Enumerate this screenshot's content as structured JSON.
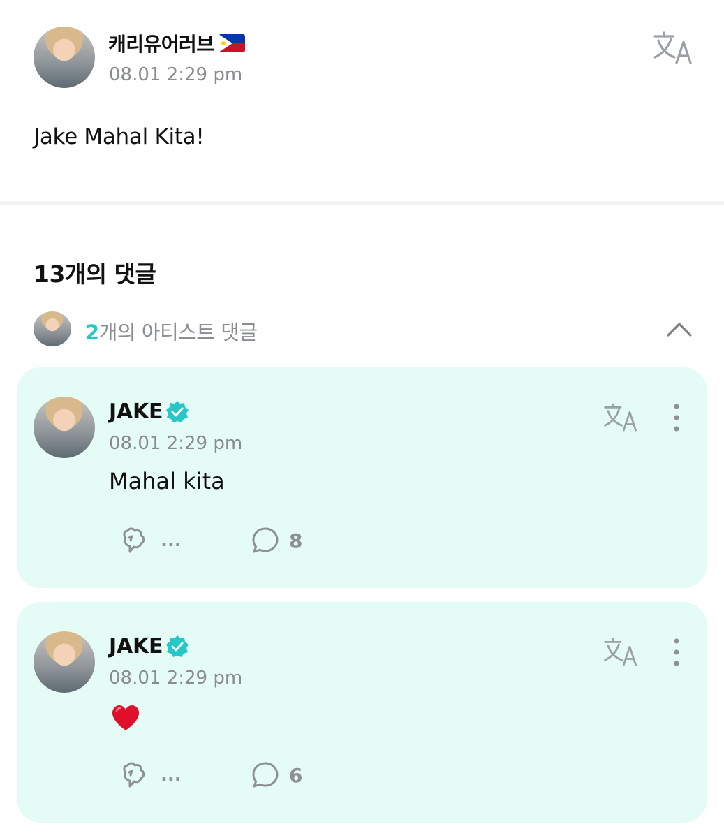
{
  "post": {
    "author": "캐리유어러브",
    "author_flag": "philippines-flag-icon",
    "timestamp": "08.01 2:29 pm",
    "body": "Jake Mahal Kita!"
  },
  "comments_section": {
    "title": "13개의 댓글",
    "artist_comments": {
      "count": "2",
      "label": "개의 아티스트 댓글"
    }
  },
  "comments": [
    {
      "author": "JAKE",
      "verified": true,
      "timestamp": "08.01 2:29 pm",
      "body": "Mahal kita",
      "reaction_count": "...",
      "reply_count": "8"
    },
    {
      "author": "JAKE",
      "verified": true,
      "timestamp": "08.01 2:29 pm",
      "body_icon": "red-heart-emoji",
      "reaction_count": "...",
      "reply_count": "6"
    }
  ],
  "colors": {
    "accent": "#27c7c7",
    "card_background": "#e5fbf6",
    "muted_text": "#888b8f"
  }
}
